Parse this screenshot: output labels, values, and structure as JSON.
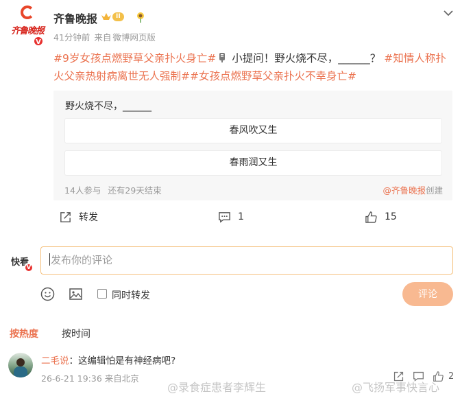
{
  "post": {
    "author": "齐鲁晚报",
    "avatar_text": "齐鲁晚报",
    "vip_level": "II",
    "verified_mark": "V",
    "time": "41分钟前",
    "source_prefix": "来自",
    "source": "微博网页版",
    "content": {
      "tag1": "#9岁女孩点燃野草父亲扑火身亡#",
      "middle": " 小提问！野火烧不尽，______？",
      "tag2": "#知情人称扑火父亲热射病离世无人强制#",
      "tag3": "#女孩点燃野草父亲扑火不幸身亡#"
    }
  },
  "poll": {
    "question": "野火烧不尽，______",
    "options": [
      "春风吹又生",
      "春雨润又生"
    ],
    "participants": "14人参与",
    "remaining": "还有29天结束",
    "creator": "@齐鲁晚报",
    "creator_suffix": "创建"
  },
  "actions": {
    "repost_label": "转发",
    "comment_count": "1",
    "like_count": "15"
  },
  "composer": {
    "user": "快看",
    "placeholder": "发布你的评论",
    "repost_option": "同时转发",
    "submit": "评论"
  },
  "sort": {
    "hot": "按热度",
    "time": "按时间"
  },
  "comments": [
    {
      "user": "二毛说",
      "separator": "：",
      "text": "这编辑怕是有神经病吧?",
      "time": "26-6-21 19:36",
      "location": "来自北京",
      "like_count": "2"
    }
  ],
  "watermarks": [
    "@录食症患者李辉生",
    "@飞扬军事快言心"
  ],
  "icons": {
    "collapse": "chevron-down-icon",
    "repost": "repost-icon",
    "comment": "comment-icon",
    "like": "thumbs-up-icon",
    "emoji": "emoji-icon",
    "image": "image-icon"
  },
  "colors": {
    "accent": "#eb7350",
    "verified": "#e8312f",
    "submit_disabled": "#f8b991",
    "input_border": "#f5c07c"
  }
}
